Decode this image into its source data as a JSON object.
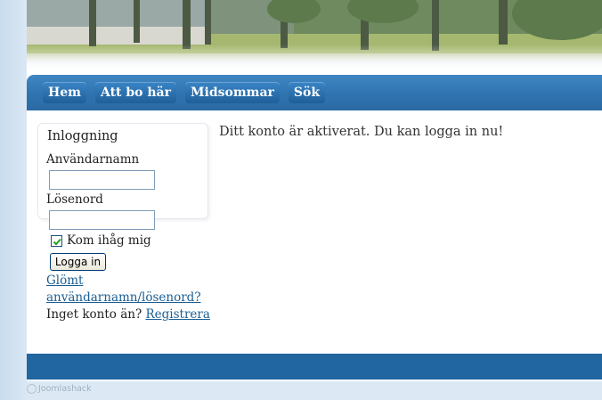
{
  "nav": {
    "items": [
      {
        "label": "Hem"
      },
      {
        "label": "Att bo här"
      },
      {
        "label": "Midsommar"
      },
      {
        "label": "Sök"
      }
    ]
  },
  "login": {
    "title": "Inloggning",
    "username_label": "Användarnamn",
    "username_value": "",
    "password_label": "Lösenord",
    "password_value": "",
    "remember_label": "Kom ihåg mig",
    "remember_checked": true,
    "submit_label": "Logga in",
    "forgot_link": "Glömt användarnamn/lösenord?",
    "no_account_text": "Inget konto än?",
    "register_link": "Registrera"
  },
  "main": {
    "message": "Ditt konto är aktiverat. Du kan logga in nu!"
  },
  "footer": {
    "credit": "Joomlashack"
  },
  "colors": {
    "nav_bar": "#2f74b0",
    "footer_bar": "#2166a0",
    "link": "#1b5e92"
  }
}
